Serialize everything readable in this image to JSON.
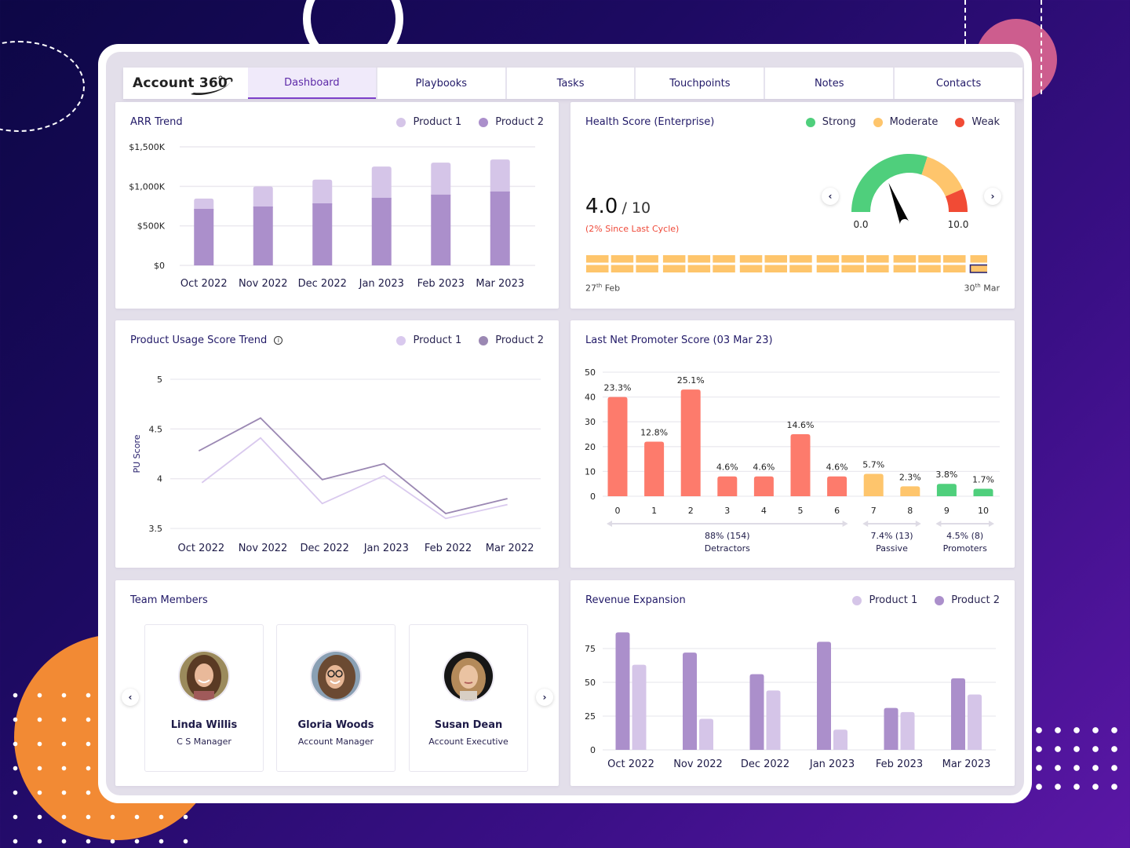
{
  "app": {
    "logo_text": "Account 360",
    "tabs": [
      {
        "label": "Dashboard",
        "active": true
      },
      {
        "label": "Playbooks",
        "active": false
      },
      {
        "label": "Tasks",
        "active": false
      },
      {
        "label": "Touchpoints",
        "active": false
      },
      {
        "label": "Notes",
        "active": false
      },
      {
        "label": "Contacts",
        "active": false
      }
    ]
  },
  "colors": {
    "product1": "#d5c5e8",
    "product2": "#ab8fcb",
    "pu_product1": "#d9c9ee",
    "pu_product2": "#9b88b3",
    "strong": "#4fcf7c",
    "moderate": "#fec56c",
    "weak": "#f14b35",
    "detractor": "#fd7b6c",
    "passive": "#fec56c",
    "promoter": "#4fcf7c",
    "accent": "#7d3fc9",
    "title": "#221a68"
  },
  "arr": {
    "title": "ARR Trend",
    "legend": [
      "Product 1",
      "Product 2"
    ]
  },
  "health": {
    "title": "Health Score (Enterprise)",
    "legend": [
      "Strong",
      "Moderate",
      "Weak"
    ],
    "score": "4.0",
    "out_of": "/ 10",
    "change": "(2% Since Last Cycle)",
    "gauge_min_label": "0.0",
    "gauge_max_label": "10.0",
    "gauge_value": 4.0,
    "gauge_needle_fraction": 0.38,
    "gauge_bands": [
      {
        "name": "Strong",
        "from": 0,
        "to": 0.6
      },
      {
        "name": "Moderate",
        "from": 0.6,
        "to": 0.87
      },
      {
        "name": "Weak",
        "from": 0.87,
        "to": 1.0
      }
    ],
    "heatmap_columns": 16,
    "heatmap_rows": 2,
    "heatmap_status": "moderate",
    "heatmap_selected": {
      "row": 1,
      "col": 15
    },
    "start_day": "27",
    "start_suffix": "th",
    "start_month": "Feb",
    "end_day": "30",
    "end_suffix": "th",
    "end_month": "Mar",
    "prev_icon": "chevron-left-icon",
    "next_icon": "chevron-right-icon"
  },
  "pu": {
    "title": "Product Usage Score Trend",
    "info_icon": "info-icon",
    "legend": [
      "Product 1",
      "Product 2"
    ]
  },
  "nps": {
    "title": "Last Net Promoter Score (03 Mar 23)",
    "groups": [
      {
        "value": "88% (154)",
        "label": "Detractors"
      },
      {
        "value": "7.4% (13)",
        "label": "Passive"
      },
      {
        "value": "4.5% (8)",
        "label": "Promoters"
      }
    ]
  },
  "team": {
    "title": "Team Members",
    "members": [
      {
        "name": "Linda Willis",
        "role": "C S Manager"
      },
      {
        "name": "Gloria Woods",
        "role": "Account Manager"
      },
      {
        "name": "Susan Dean",
        "role": "Account Executive"
      }
    ],
    "prev_icon": "chevron-left-icon",
    "next_icon": "chevron-right-icon"
  },
  "revenue": {
    "title": "Revenue Expansion",
    "legend": [
      "Product 1",
      "Product 2"
    ]
  },
  "chart_data": [
    {
      "id": "arr",
      "type": "bar",
      "stacked": true,
      "title": "ARR Trend",
      "categories": [
        "Oct 2022",
        "Nov 2022",
        "Dec 2022",
        "Jan 2023",
        "Feb 2023",
        "Mar 2023"
      ],
      "series": [
        {
          "name": "Product 2",
          "values": [
            715,
            745,
            785,
            855,
            895,
            935
          ]
        },
        {
          "name": "Product 1",
          "values": [
            130,
            255,
            300,
            395,
            405,
            405
          ]
        }
      ],
      "unit": "$K",
      "yticks": [
        "$0",
        "$500K",
        "$1,000K",
        "$1,500K"
      ],
      "ytick_values": [
        0,
        500,
        1000,
        1500
      ],
      "ylim": [
        0,
        1500
      ],
      "grid": true,
      "legend_position": "top-right"
    },
    {
      "id": "pu",
      "type": "line",
      "title": "Product Usage Score Trend",
      "ylabel": "PU Score",
      "categories": [
        "Oct 2022",
        "Nov 2022",
        "Dec 2022",
        "Jan 2023",
        "Feb 2022",
        "Mar 2022"
      ],
      "series": [
        {
          "name": "Product 1",
          "values": [
            3.96,
            4.41,
            3.75,
            4.03,
            3.6,
            3.74
          ]
        },
        {
          "name": "Product 2",
          "values": [
            4.28,
            4.61,
            3.99,
            4.15,
            3.65,
            3.8
          ]
        }
      ],
      "yticks": [
        "3.5",
        "4",
        "4.5",
        "5"
      ],
      "ytick_values": [
        3.5,
        4,
        4.5,
        5
      ],
      "ylim": [
        3.5,
        5
      ],
      "grid": true,
      "legend_position": "top-right"
    },
    {
      "id": "nps",
      "type": "bar",
      "title": "Last Net Promoter Score (03 Mar 23)",
      "categories": [
        "0",
        "1",
        "2",
        "3",
        "4",
        "5",
        "6",
        "7",
        "8",
        "9",
        "10"
      ],
      "values": [
        40,
        22,
        43,
        8,
        8,
        25,
        8,
        9,
        4,
        5,
        3
      ],
      "labels": [
        "23.3%",
        "12.8%",
        "25.1%",
        "4.6%",
        "4.6%",
        "14.6%",
        "4.6%",
        "5.7%",
        "2.3%",
        "3.8%",
        "1.7%"
      ],
      "groups": [
        "detractor",
        "detractor",
        "detractor",
        "detractor",
        "detractor",
        "detractor",
        "detractor",
        "passive",
        "passive",
        "promoter",
        "promoter"
      ],
      "yticks": [
        "0",
        "10",
        "20",
        "30",
        "40",
        "50"
      ],
      "ytick_values": [
        0,
        10,
        20,
        30,
        40,
        50
      ],
      "ylim": [
        0,
        50
      ],
      "grid": true
    },
    {
      "id": "revenue",
      "type": "bar",
      "title": "Revenue Expansion",
      "categories": [
        "Oct 2022",
        "Nov 2022",
        "Dec 2022",
        "Jan 2023",
        "Feb 2023",
        "Mar 2023"
      ],
      "series": [
        {
          "name": "Product 2",
          "values": [
            87,
            72,
            56,
            80,
            31,
            53
          ]
        },
        {
          "name": "Product 1",
          "values": [
            63,
            23,
            44,
            15,
            28,
            41
          ]
        }
      ],
      "yticks": [
        "0",
        "25",
        "50",
        "75"
      ],
      "ytick_values": [
        0,
        25,
        50,
        75
      ],
      "ylim": [
        0,
        87
      ],
      "grid": true,
      "legend_position": "top-right"
    }
  ]
}
